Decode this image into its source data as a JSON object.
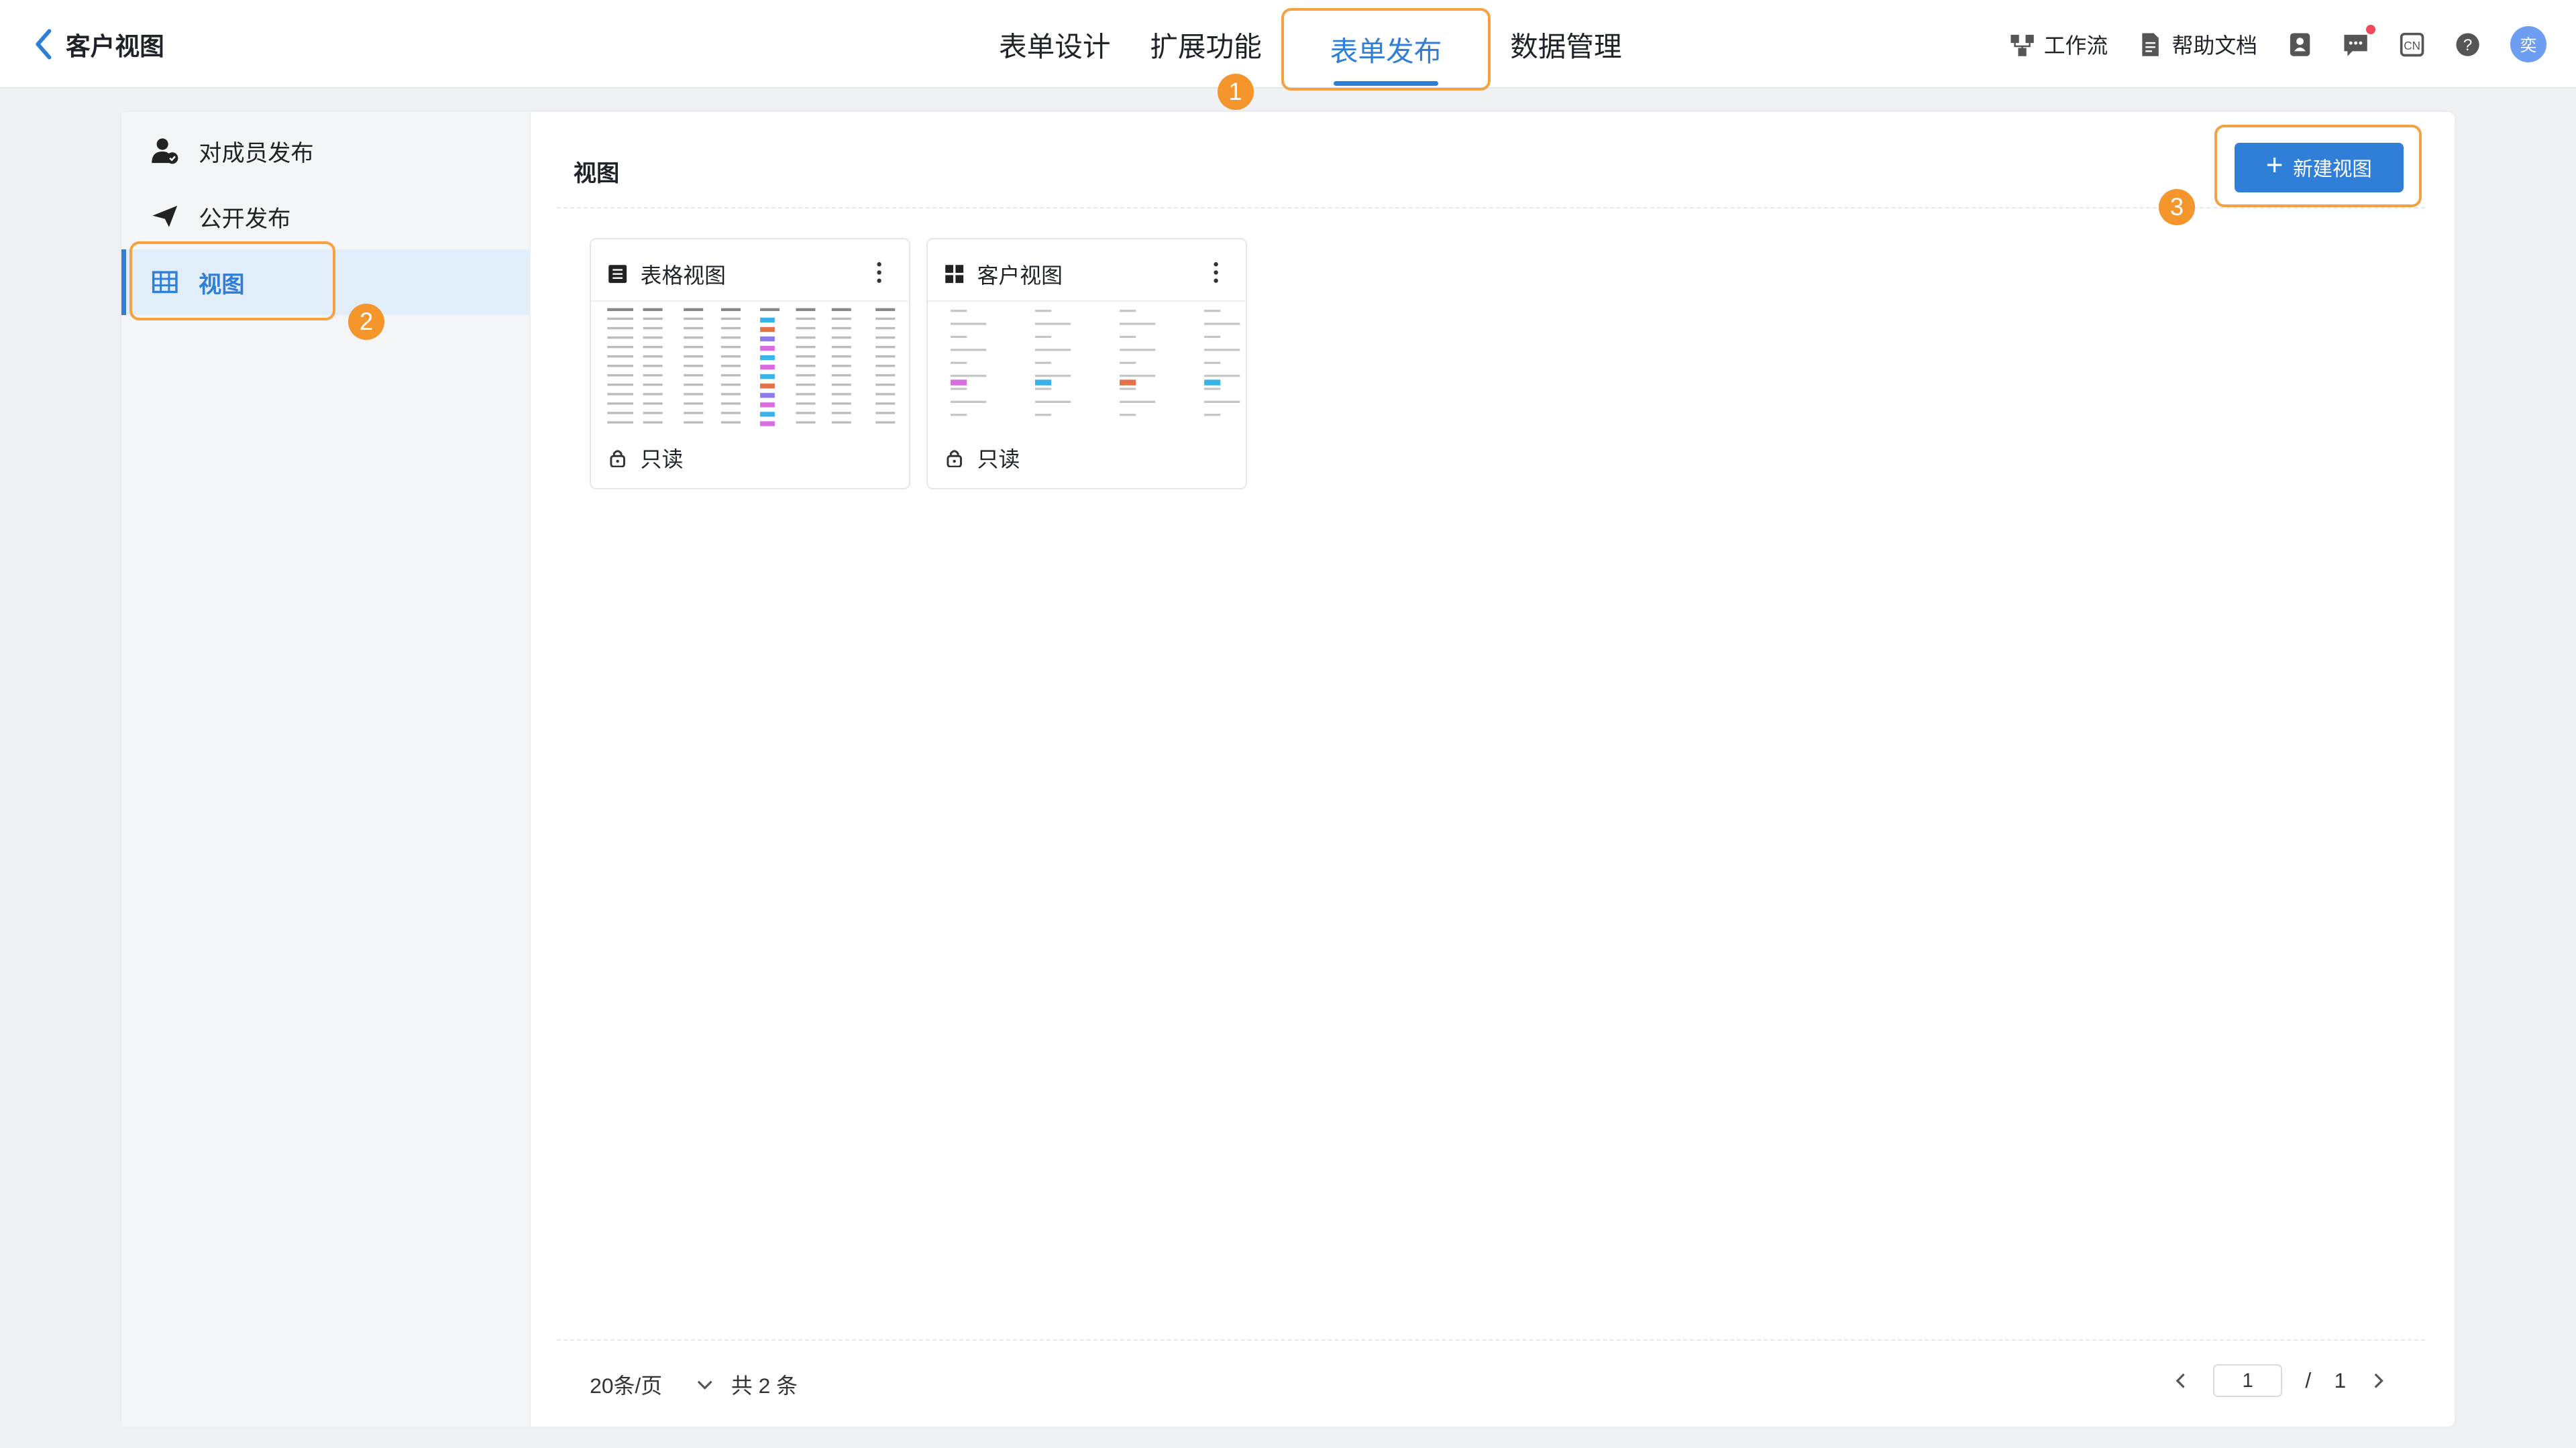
{
  "header": {
    "back_title": "客户视图",
    "tabs": [
      {
        "label": "表单设计"
      },
      {
        "label": "扩展功能"
      },
      {
        "label": "表单发布"
      },
      {
        "label": "数据管理"
      }
    ],
    "active_tab": "表单发布",
    "tools": {
      "workflow": "工作流",
      "help_docs": "帮助文档",
      "lang": "CN",
      "avatar": "奕"
    }
  },
  "annotations": [
    "1",
    "2",
    "3"
  ],
  "sidebar": {
    "items": [
      {
        "label": "对成员发布",
        "icon": "user-publish-icon"
      },
      {
        "label": "公开发布",
        "icon": "send-icon"
      },
      {
        "label": "视图",
        "icon": "table-icon"
      }
    ],
    "active": "视图"
  },
  "content": {
    "title": "视图",
    "new_button": "新建视图",
    "cards": [
      {
        "title": "表格视图",
        "icon": "list-icon",
        "access": "只读"
      },
      {
        "title": "客户视图",
        "icon": "grid-icon",
        "access": "只读"
      }
    ]
  },
  "pagination": {
    "page_size": "20条/页",
    "total": "共 2 条",
    "current_page": "1",
    "separator": "/",
    "total_pages": "1"
  },
  "colors": {
    "accent": "#2f7fd8",
    "highlight_border": "#f5a041",
    "badge": "#f5962c"
  }
}
